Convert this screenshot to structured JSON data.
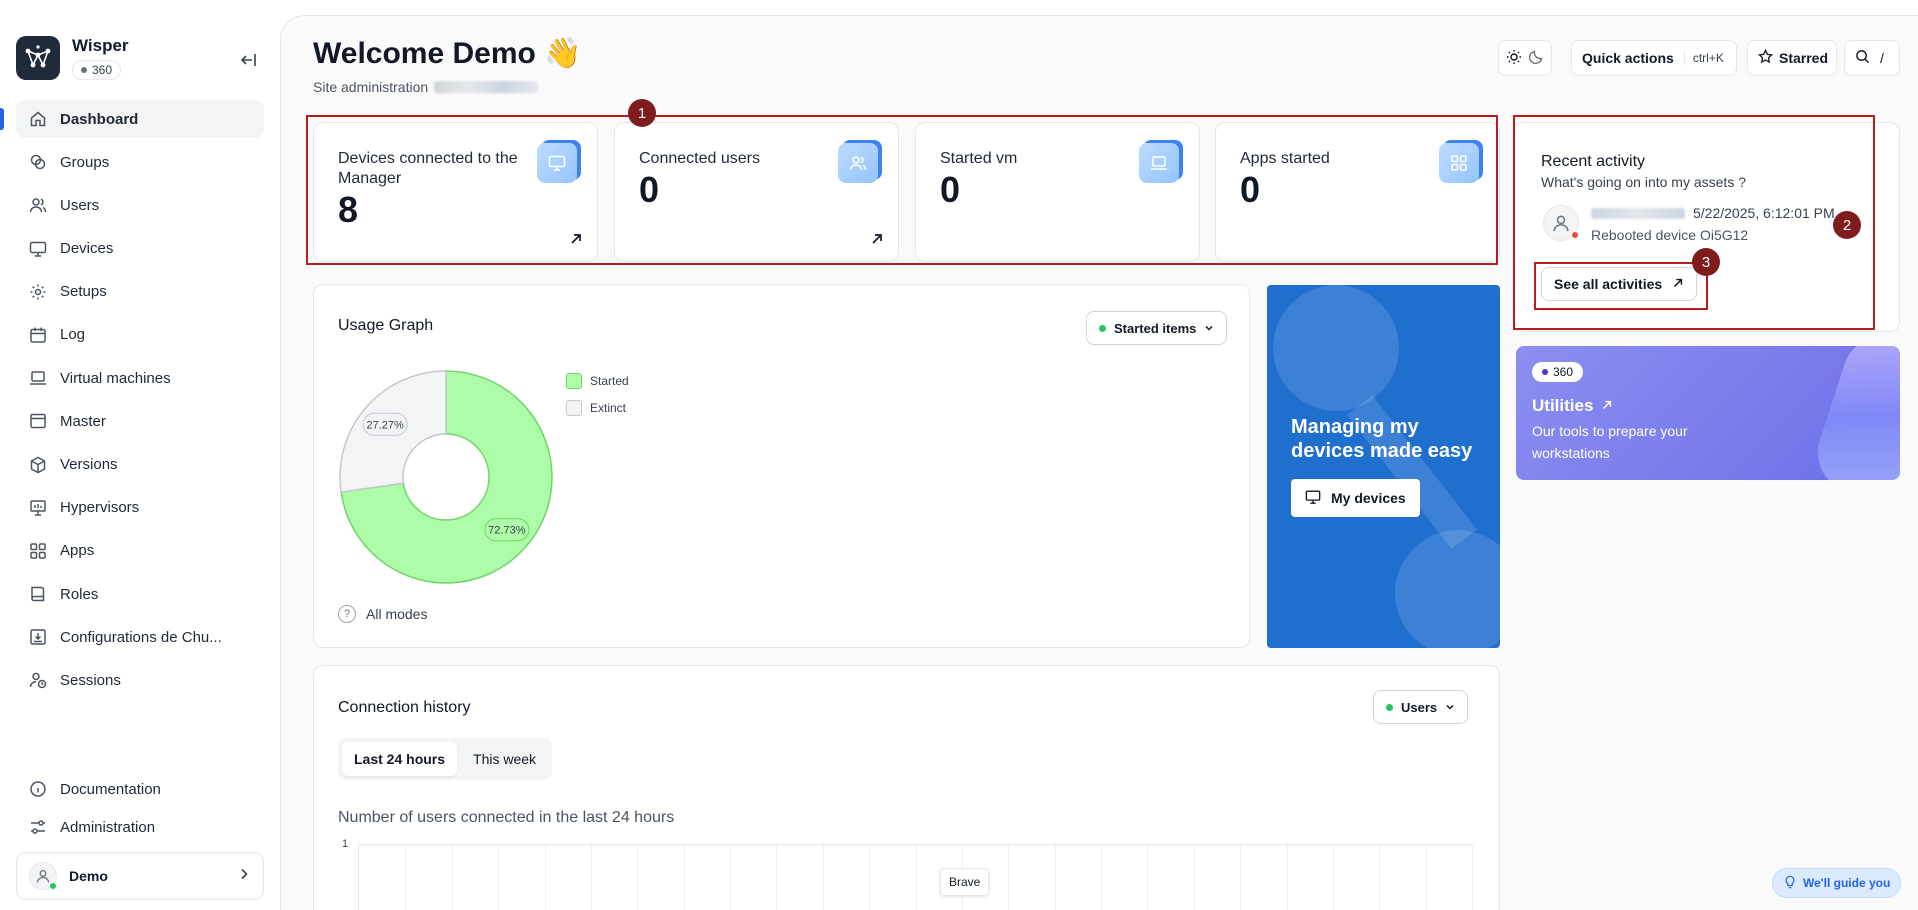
{
  "brand": {
    "name": "Wisper",
    "badge": "360"
  },
  "sidebar": {
    "items": [
      {
        "label": "Dashboard",
        "icon": "home-icon",
        "active": true
      },
      {
        "label": "Groups",
        "icon": "groups-icon"
      },
      {
        "label": "Users",
        "icon": "users-icon"
      },
      {
        "label": "Devices",
        "icon": "monitor-icon"
      },
      {
        "label": "Setups",
        "icon": "gear-icon"
      },
      {
        "label": "Log",
        "icon": "calendar-icon"
      },
      {
        "label": "Virtual machines",
        "icon": "laptop-icon"
      },
      {
        "label": "Master",
        "icon": "window-icon"
      },
      {
        "label": "Versions",
        "icon": "package-icon"
      },
      {
        "label": "Hypervisors",
        "icon": "presentation-icon"
      },
      {
        "label": "Apps",
        "icon": "grid-icon"
      },
      {
        "label": "Roles",
        "icon": "book-icon"
      },
      {
        "label": "Configurations de Chu...",
        "icon": "download-box-icon"
      },
      {
        "label": "Sessions",
        "icon": "user-clock-icon"
      }
    ],
    "bottom": [
      {
        "label": "Documentation",
        "icon": "info-icon"
      },
      {
        "label": "Administration",
        "icon": "sliders-icon"
      }
    ],
    "user": {
      "name": "Demo"
    }
  },
  "header": {
    "title": "Welcome Demo 👋",
    "subtitle": "Site administration",
    "quick_actions": "Quick actions",
    "quick_actions_kbd": "ctrl+K",
    "starred": "Starred",
    "search_kbd": "/"
  },
  "stats": [
    {
      "label": "Devices connected to the Manager",
      "value": "8",
      "icon": "monitor-icon"
    },
    {
      "label": "Connected users",
      "value": "0",
      "icon": "users-icon"
    },
    {
      "label": "Started vm",
      "value": "0",
      "icon": "laptop-icon"
    },
    {
      "label": "Apps started",
      "value": "0",
      "icon": "grid-icon"
    }
  ],
  "activity": {
    "title": "Recent activity",
    "subtitle": "What's going on into my assets ?",
    "timestamp": "5/22/2025, 6:12:01 PM",
    "text": "Rebooted device Oi5G12",
    "see_all": "See all activities"
  },
  "utilities": {
    "badge": "360",
    "title": "Utilities",
    "description": "Our tools to prepare your workstations"
  },
  "usage": {
    "title": "Usage Graph",
    "dropdown": "Started items",
    "all_modes": "All modes",
    "legend": [
      {
        "label": "Started",
        "color": "#adfca8"
      },
      {
        "label": "Extinct",
        "color": "#f3f4f6"
      }
    ]
  },
  "chart_data": {
    "type": "pie",
    "categories": [
      "Started",
      "Extinct"
    ],
    "values": [
      72.73,
      27.27
    ],
    "labels": [
      "72.73%",
      "27.27%"
    ],
    "colors": [
      "#adfca8",
      "#f3f4f6"
    ],
    "stroke_colors": [
      "#6fd46a",
      "#c4c7cc"
    ]
  },
  "promo": {
    "title": "Managing my devices made easy",
    "button": "My devices"
  },
  "connection": {
    "title": "Connection history",
    "dropdown": "Users",
    "tabs": [
      "Last 24 hours",
      "This week"
    ],
    "chart_subtitle": "Number of users connected in the last 24 hours",
    "y_tick": "1",
    "tooltip": "Brave"
  },
  "annotations": [
    "1",
    "2",
    "3"
  ],
  "guide": "We'll guide you",
  "colors": {
    "accent": "#2563eb",
    "annotation": "#b91c1c",
    "promo": "#1f6fcf"
  }
}
